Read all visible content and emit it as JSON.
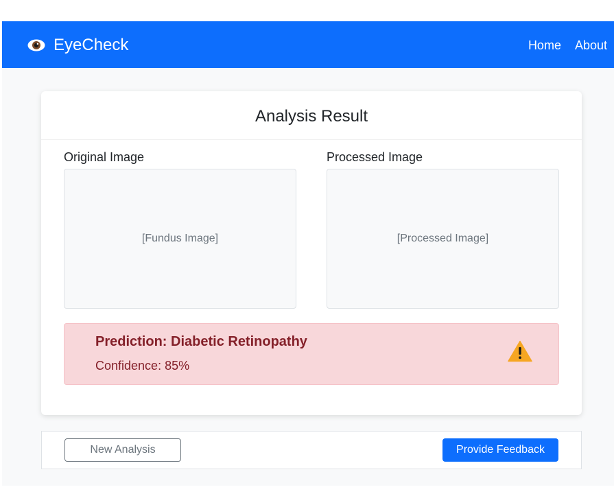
{
  "navbar": {
    "brand": "EyeCheck",
    "brand_icon": "eye-icon",
    "links": [
      "Home",
      "About"
    ],
    "color": "#0d6efd"
  },
  "card": {
    "title": "Analysis Result",
    "original": {
      "label": "Original Image",
      "placeholder": "[Fundus Image]"
    },
    "processed": {
      "label": "Processed Image",
      "placeholder": "[Processed Image]"
    },
    "prediction": {
      "title": "Prediction: Diabetic Retinopathy",
      "confidence": "Confidence: 85%",
      "icon": "warning-icon",
      "alert_bg": "#f8d7da",
      "alert_text": "#842029"
    }
  },
  "actions": {
    "new_analysis": "New Analysis",
    "feedback": "Provide Feedback"
  }
}
